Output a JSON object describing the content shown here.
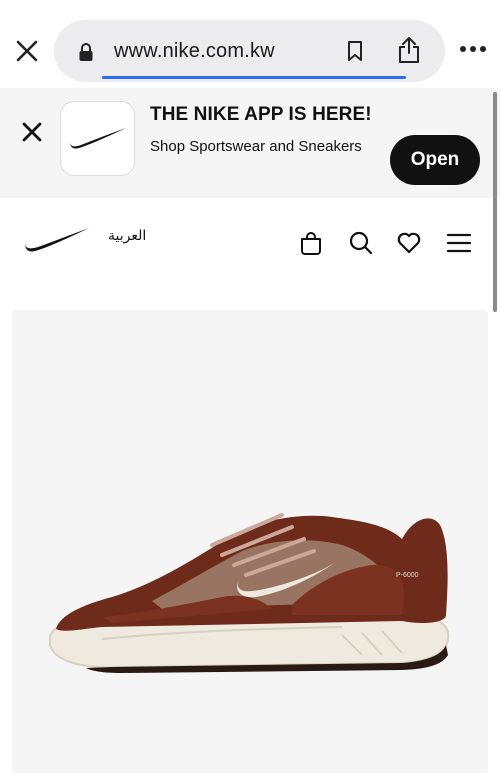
{
  "browser": {
    "url": "www.nike.com.kw",
    "icons": [
      "close-icon",
      "lock-icon",
      "bookmark-icon",
      "share-icon",
      "more-icon"
    ]
  },
  "app_banner": {
    "title": "THE NIKE APP IS HERE!",
    "subtitle": "Shop Sportswear and Sneakers",
    "open_label": "Open"
  },
  "header": {
    "language_link": "العربية",
    "icons": [
      "bag-icon",
      "search-icon",
      "heart-icon",
      "menu-icon"
    ]
  },
  "product": {
    "image_model_text": "P-6000"
  },
  "colors": {
    "brand_black": "#111111",
    "banner_bg": "#f5f5f5",
    "url_bar_bg": "#ececee",
    "load_accent": "#2a6df0",
    "shoe_brown": "#6e2a1a",
    "shoe_sole": "#efeadf"
  }
}
